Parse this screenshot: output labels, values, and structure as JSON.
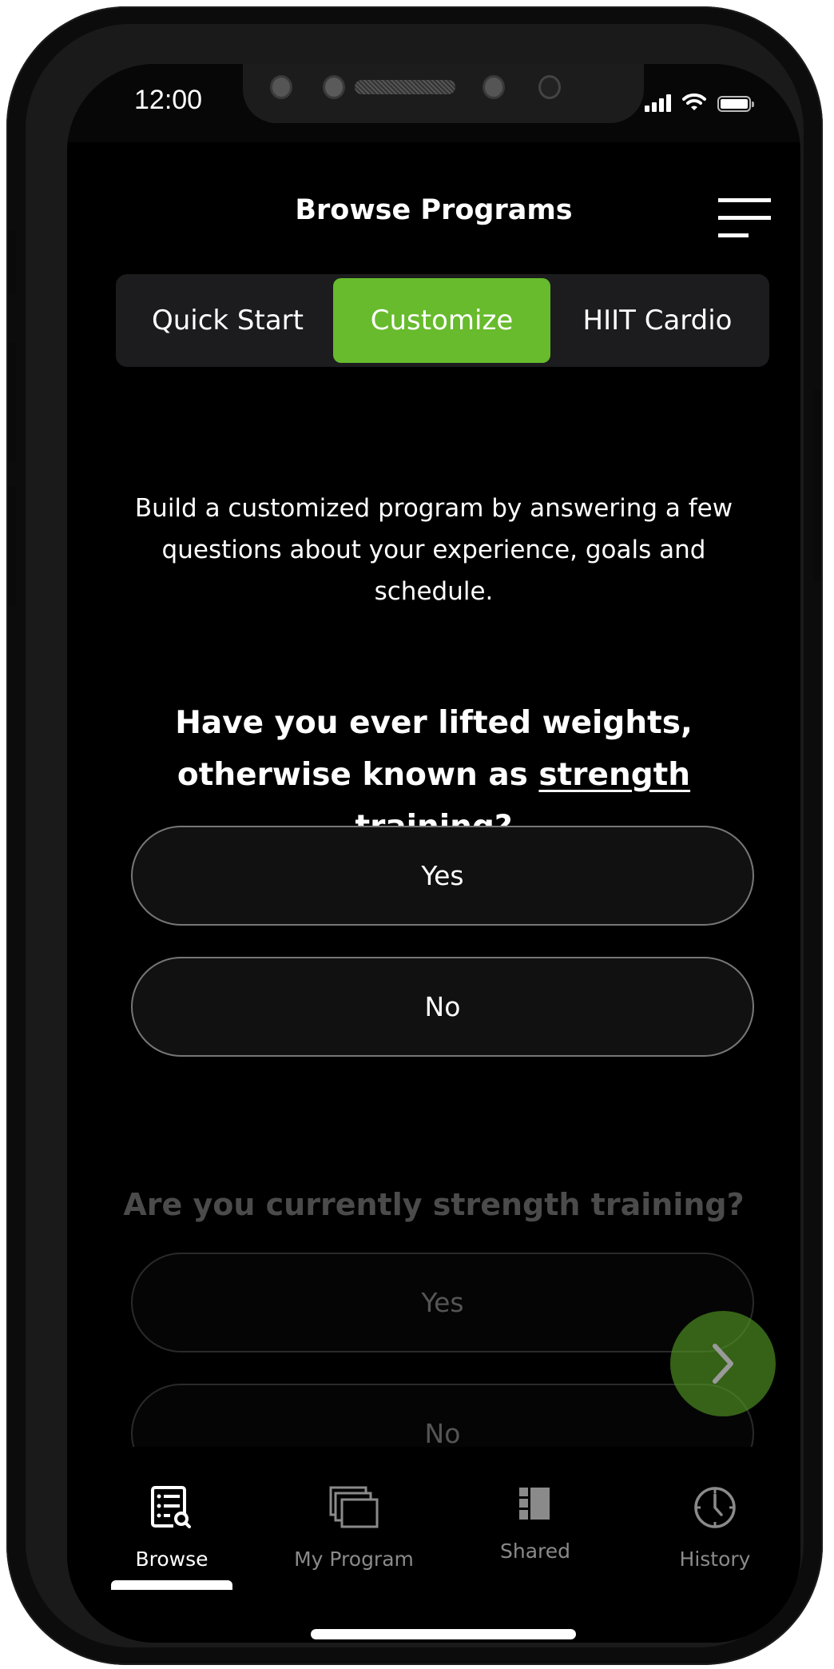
{
  "status_bar": {
    "time": "12:00",
    "signal_icon": "cellular-signal-icon",
    "wifi_icon": "wifi-icon",
    "battery_icon": "battery-icon"
  },
  "header": {
    "title": "Browse Programs",
    "menu_icon": "hamburger-menu-icon"
  },
  "tabs": [
    {
      "label": "Quick Start",
      "active": false
    },
    {
      "label": "Customize",
      "active": true
    },
    {
      "label": "HIIT Cardio",
      "active": false
    }
  ],
  "description": "Build a customized program by answering a few questions about your experience, goals and schedule.",
  "question1": {
    "prefix": "Have you ever lifted weights, otherwise known as ",
    "link": "strength training",
    "suffix": "?",
    "options": [
      "Yes",
      "No"
    ]
  },
  "question2": {
    "text": "Are you currently strength training?",
    "options": [
      "Yes",
      "No"
    ],
    "state": "disabled"
  },
  "next_button": {
    "icon": "chevron-right-icon"
  },
  "bottom_nav": {
    "items": [
      {
        "label": "Browse",
        "icon": "browse-list-search-icon",
        "active": true
      },
      {
        "label": "My Program",
        "icon": "stacked-cards-icon",
        "active": false
      },
      {
        "label": "Shared",
        "icon": "shared-panel-icon",
        "active": false
      },
      {
        "label": "History",
        "icon": "clock-icon",
        "active": false
      }
    ]
  },
  "colors": {
    "accent": "#67bb2c",
    "background": "#000000",
    "inactive": "#8a8a8a",
    "option_border": "#777777"
  }
}
